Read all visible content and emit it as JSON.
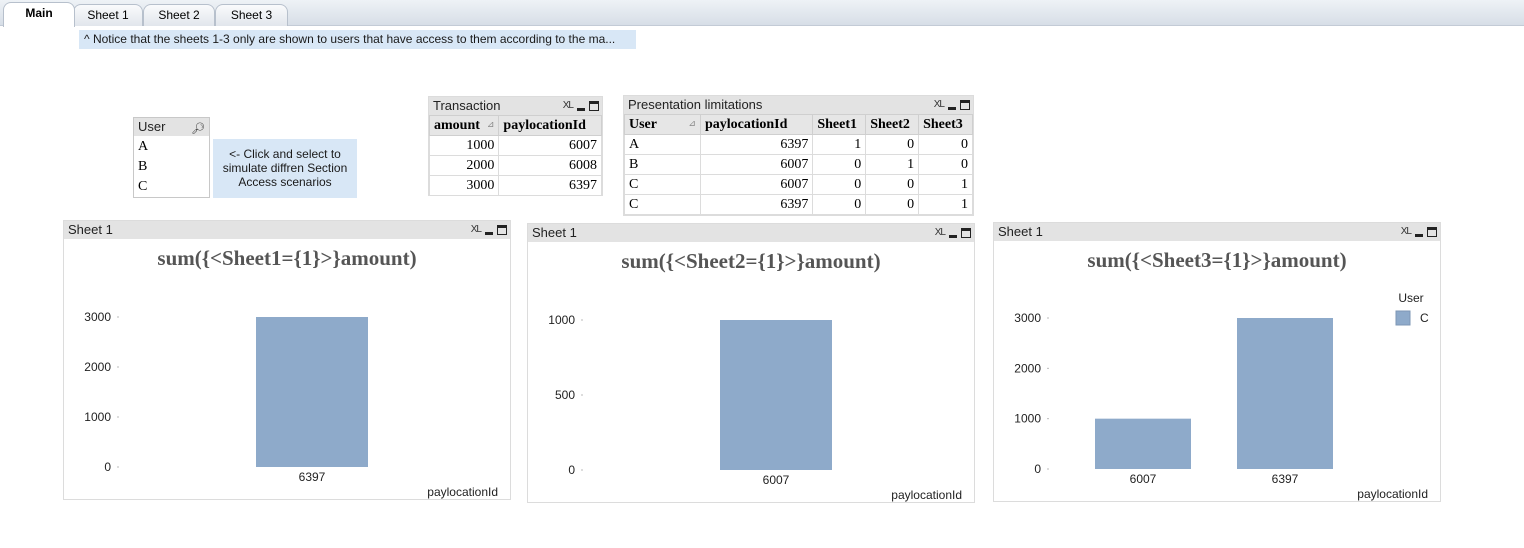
{
  "tabs": [
    {
      "label": "Main",
      "active": true
    },
    {
      "label": "Sheet 1",
      "active": false
    },
    {
      "label": "Sheet 2",
      "active": false
    },
    {
      "label": "Sheet 3",
      "active": false
    }
  ],
  "notice": "^ Notice that the sheets 1-3 only are shown to users that have access to them according to the ma...",
  "listbox": {
    "title": "User",
    "items": [
      "A",
      "B",
      "C"
    ]
  },
  "hint": "<- Click and select to simulate diffren Section Access scenarios",
  "caption_buttons": {
    "xl": "XL"
  },
  "transaction": {
    "title": "Transaction",
    "columns": [
      "amount",
      "paylocationId"
    ],
    "rows": [
      [
        "1000",
        "6007"
      ],
      [
        "2000",
        "6008"
      ],
      [
        "3000",
        "6397"
      ]
    ]
  },
  "presentation": {
    "title": "Presentation limitations",
    "columns": [
      "User",
      "paylocationId",
      "Sheet1",
      "Sheet2",
      "Sheet3"
    ],
    "rows": [
      [
        "A",
        "6397",
        "1",
        "0",
        "0"
      ],
      [
        "B",
        "6007",
        "0",
        "1",
        "0"
      ],
      [
        "C",
        "6007",
        "0",
        "0",
        "1"
      ],
      [
        "C",
        "6397",
        "0",
        "0",
        "1"
      ]
    ]
  },
  "colors": {
    "bar": "#8eaaca",
    "caption_bg": "#e3e3e3",
    "notice_bg": "#d8e7f6"
  },
  "chart_data": [
    {
      "type": "bar",
      "window_title": "Sheet 1",
      "title": "sum({<Sheet1={1}>}amount)",
      "categories": [
        "6397"
      ],
      "values": [
        3000
      ],
      "xlabel": "paylocationId",
      "ylabel": "",
      "ylim": [
        0,
        3000
      ],
      "yticks": [
        0,
        1000,
        2000,
        3000
      ],
      "legend": null
    },
    {
      "type": "bar",
      "window_title": "Sheet 1",
      "title": "sum({<Sheet2={1}>}amount)",
      "categories": [
        "6007"
      ],
      "values": [
        1000
      ],
      "xlabel": "paylocationId",
      "ylabel": "",
      "ylim": [
        0,
        1000
      ],
      "yticks": [
        0,
        500,
        1000
      ],
      "legend": null
    },
    {
      "type": "bar",
      "window_title": "Sheet 1",
      "title": "sum({<Sheet3={1}>}amount)",
      "categories": [
        "6007",
        "6397"
      ],
      "values": [
        1000,
        3000
      ],
      "xlabel": "paylocationId",
      "ylabel": "",
      "ylim": [
        0,
        3000
      ],
      "yticks": [
        0,
        1000,
        2000,
        3000
      ],
      "legend": {
        "title": "User",
        "entries": [
          "C"
        ],
        "placement": "top-right"
      }
    }
  ]
}
